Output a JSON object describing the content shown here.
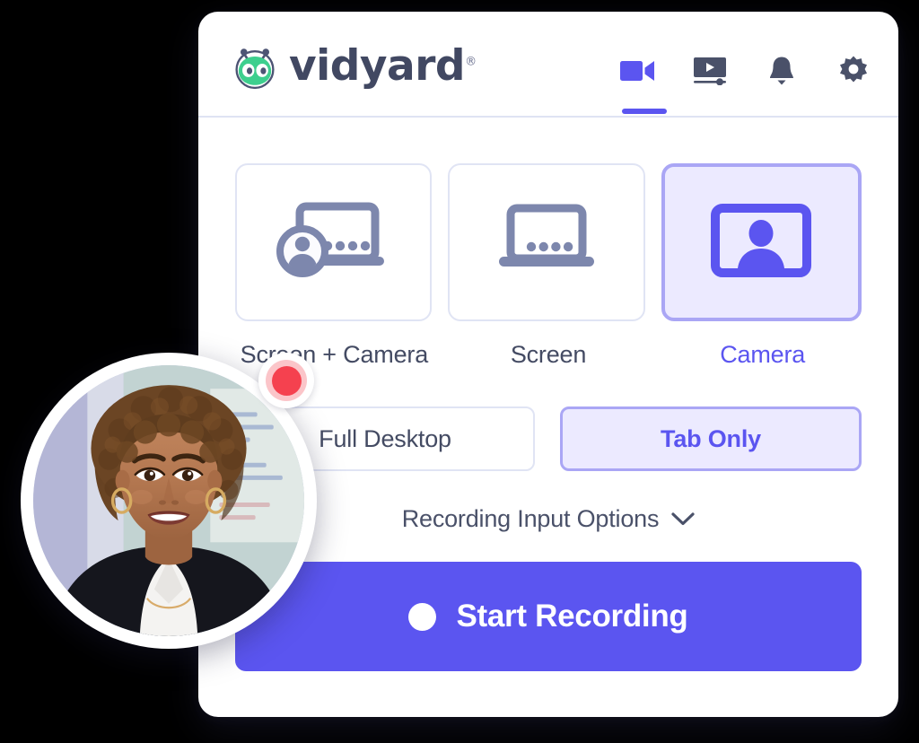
{
  "window": {
    "background_color": "#ffffff",
    "accent_color": "#5b55f0",
    "accent_light_color": "#eceaff",
    "accent_border_color": "#aaa6f5",
    "text_color": "#444b63",
    "border_color": "#e0e4f4"
  },
  "header": {
    "brand_name": "vidyard",
    "brand_registered_mark": "®",
    "brand_logo_icon": "vidyard-robot-logo",
    "brand_logo_color": "#3ecf8e",
    "actions": [
      {
        "name": "video-camera-icon",
        "label": "Record",
        "active": true,
        "color": "#5b55f0"
      },
      {
        "name": "video-library-icon",
        "label": "Library",
        "active": false,
        "color": "#4a5169"
      },
      {
        "name": "bell-icon",
        "label": "Notifications",
        "active": false,
        "color": "#4a5169"
      },
      {
        "name": "gear-icon",
        "label": "Settings",
        "active": false,
        "color": "#4a5169"
      }
    ]
  },
  "main": {
    "modes": [
      {
        "id": "screen-camera",
        "label": "Screen + Camera",
        "icon": "screen-plus-camera-icon",
        "selected": false
      },
      {
        "id": "screen",
        "label": "Screen",
        "icon": "screen-icon",
        "selected": false
      },
      {
        "id": "camera",
        "label": "Camera",
        "icon": "camera-person-icon",
        "selected": true
      }
    ],
    "scope_options": [
      {
        "id": "full-desktop",
        "label": "Full Desktop",
        "selected": false
      },
      {
        "id": "tab-only",
        "label": "Tab Only",
        "selected": true
      }
    ],
    "recording_input_options": {
      "label": "Recording Input Options",
      "icon": "chevron-down-icon",
      "expanded": false
    },
    "start_button": {
      "label": "Start Recording",
      "icon": "record-dot-icon",
      "background_color": "#5b55f0",
      "text_color": "#ffffff"
    }
  },
  "webcam_overlay": {
    "name": "webcam-preview-bubble",
    "subject": "smiling-woman-headshot",
    "record_indicator": {
      "name": "record-indicator",
      "dot_color": "#f5414f",
      "ring_color": "#fbc5c9"
    }
  }
}
